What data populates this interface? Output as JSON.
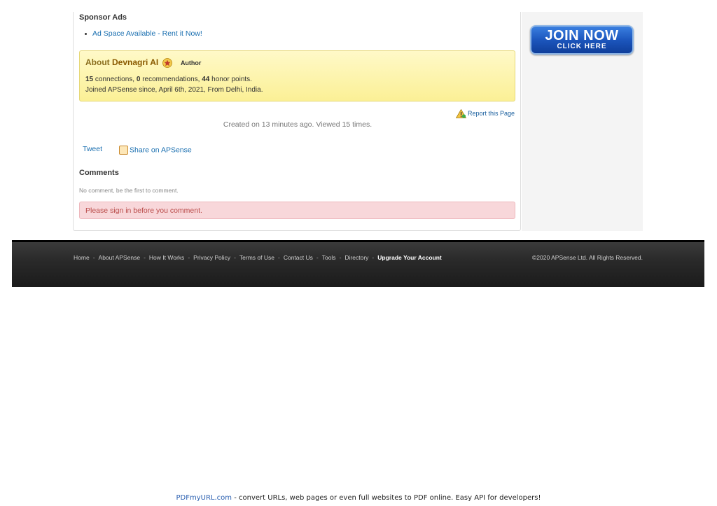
{
  "sponsor": {
    "title": "Sponsor Ads",
    "ad_link": "Ad Space Available - Rent it Now!"
  },
  "about": {
    "prefix": "About",
    "name": "Devnagri AI",
    "badge": "Author",
    "connections": "15",
    "connections_label": "connections,",
    "recommendations": "0",
    "recommendations_label": "recommendations,",
    "honor_points": "44",
    "honor_label": "honor points.",
    "joined": "Joined APSense since, April 6th, 2021, From Delhi, India."
  },
  "report": {
    "label": "Report this Page",
    "icon": "warning-icon"
  },
  "created_text": "Created on 13 minutes ago. Viewed 15 times.",
  "share": {
    "tweet": "Tweet",
    "apsense": "Share on APSense"
  },
  "comments": {
    "title": "Comments",
    "empty": "No comment, be the first to comment.",
    "signin": "Please sign in before you comment."
  },
  "join_button": {
    "line1": "JOIN NOW",
    "line2": "CLICK HERE"
  },
  "footer": {
    "links": [
      "Home",
      "About APSense",
      "How It Works",
      "Privacy Policy",
      "Terms of Use",
      "Contact Us",
      "Tools",
      "Directory"
    ],
    "upgrade": "Upgrade Your Account",
    "separator": "-",
    "copyright": "©2020 APSense Ltd. All Rights Reserved."
  },
  "pdf_note": {
    "link": "PDFmyURL.com",
    "text": " - convert URLs, web pages or even full websites to PDF online. Easy API for developers!"
  },
  "colors": {
    "link": "#1a6fb0",
    "about_bg": "#fbf096",
    "signin_bg": "#f8d7da",
    "join_blue": "#1c56bd",
    "footer_bg": "#2a2a2a"
  }
}
